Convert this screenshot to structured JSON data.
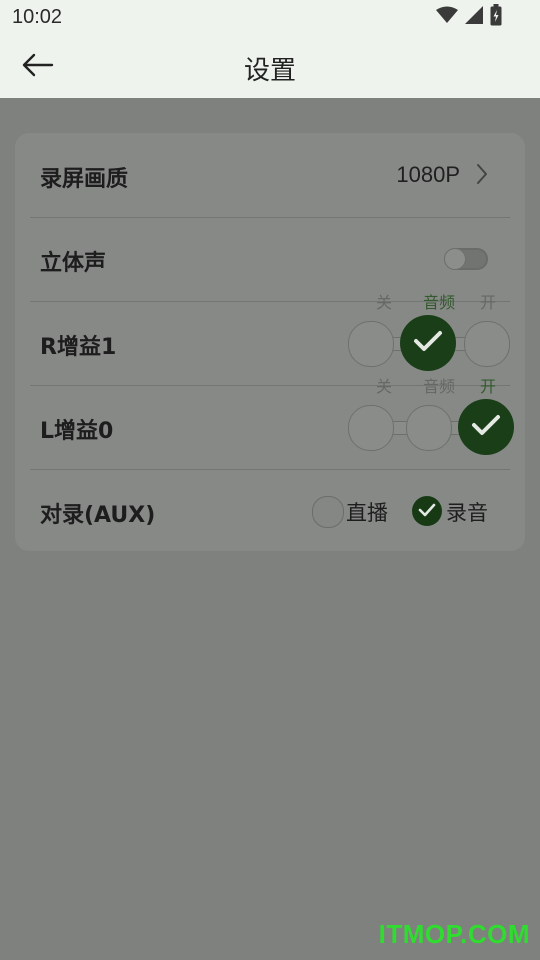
{
  "status": {
    "time": "10:02",
    "icons": [
      "wifi-icon",
      "signal-icon",
      "battery-charging-icon"
    ]
  },
  "appbar": {
    "back_icon": "arrow-left-icon",
    "title": "设置"
  },
  "settings": {
    "quality": {
      "label": "录屏画质",
      "value": "1080P"
    },
    "stereo": {
      "label": "立体声",
      "enabled": false
    },
    "r_gain": {
      "label": "R增益1",
      "options": [
        "关",
        "音频",
        "开"
      ],
      "selected_index": 1
    },
    "l_gain": {
      "label": "L增益0",
      "options": [
        "关",
        "音频",
        "开"
      ],
      "selected_index": 2
    },
    "aux": {
      "label": "对录(AUX)",
      "options": [
        "直播",
        "录音"
      ],
      "selected_index": 1
    }
  },
  "watermark": "ITMOP.COM",
  "colors": {
    "overlay": "#7f817e",
    "selected_green": "#1a3e17",
    "watermark_green": "#2fdc2f"
  }
}
